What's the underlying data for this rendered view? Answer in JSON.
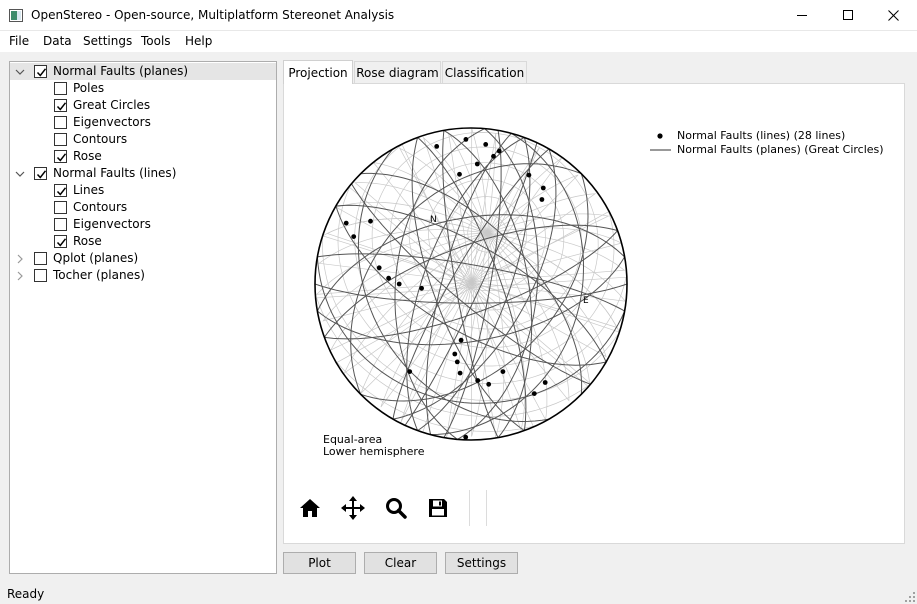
{
  "window": {
    "title": "OpenStereo - Open-source, Multiplatform Stereonet Analysis"
  },
  "menu": [
    "File",
    "Data",
    "Settings",
    "Tools",
    "Help"
  ],
  "tree": [
    {
      "label": "Normal Faults (planes)",
      "checked": true,
      "level": 0,
      "expanded": true,
      "selected": true
    },
    {
      "label": "Poles",
      "checked": false,
      "level": 1
    },
    {
      "label": "Great Circles",
      "checked": true,
      "level": 1
    },
    {
      "label": "Eigenvectors",
      "checked": false,
      "level": 1
    },
    {
      "label": "Contours",
      "checked": false,
      "level": 1
    },
    {
      "label": "Rose",
      "checked": true,
      "level": 1
    },
    {
      "label": "Normal Faults (lines)",
      "checked": true,
      "level": 0,
      "expanded": true
    },
    {
      "label": "Lines",
      "checked": true,
      "level": 1
    },
    {
      "label": "Contours",
      "checked": false,
      "level": 1
    },
    {
      "label": "Eigenvectors",
      "checked": false,
      "level": 1
    },
    {
      "label": "Rose",
      "checked": true,
      "level": 1
    },
    {
      "label": "Qplot (planes)",
      "checked": false,
      "level": 0,
      "expanded": false
    },
    {
      "label": "Tocher (planes)",
      "checked": false,
      "level": 0,
      "expanded": false
    }
  ],
  "tabs": [
    {
      "label": "Projection",
      "active": true
    },
    {
      "label": "Rose diagram",
      "active": false
    },
    {
      "label": "Classification",
      "active": false
    }
  ],
  "stereonet": {
    "north_label": "N",
    "east_label": "E",
    "projection_label": "Equal-area",
    "hemisphere_label": "Lower hemisphere",
    "legend": {
      "points_label": "Normal Faults (lines) (28 lines)",
      "lines_label": "Normal Faults (planes) (Great Circles)"
    }
  },
  "plot_toolbar": [
    "home-icon",
    "pan-icon",
    "zoom-icon",
    "save-icon"
  ],
  "buttons": {
    "plot": "Plot",
    "clear": "Clear",
    "settings": "Settings"
  },
  "status": "Ready"
}
